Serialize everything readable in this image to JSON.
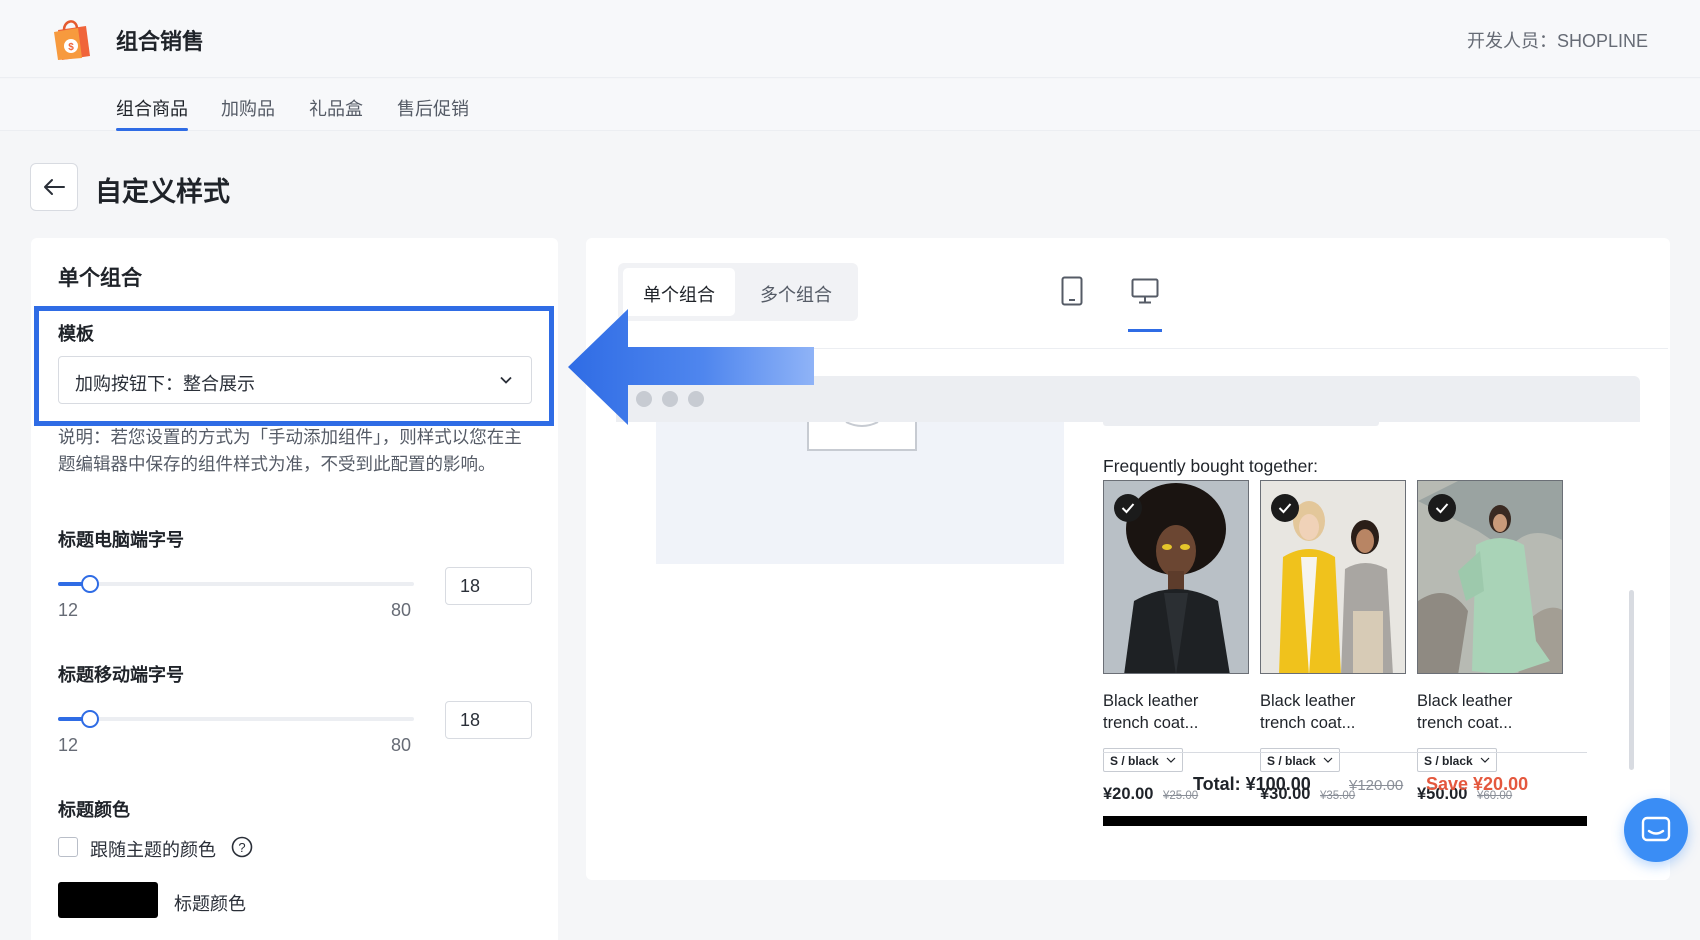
{
  "header": {
    "app_title": "组合销售",
    "developer_label": "开发人员：SHOPLINE"
  },
  "tabs": [
    {
      "label": "组合商品",
      "active": true
    },
    {
      "label": "加购品",
      "active": false
    },
    {
      "label": "礼品盒",
      "active": false
    },
    {
      "label": "售后促销",
      "active": false
    }
  ],
  "page": {
    "title": "自定义样式"
  },
  "settings": {
    "section_title": "单个组合",
    "template_label": "模板",
    "template_value": "加购按钮下：整合展示",
    "hint": "说明：若您设置的方式为「手动添加组件」，则样式以您在主题编辑器中保存的组件样式为准，不受到此配置的影响。",
    "desktop_size": {
      "label": "标题电脑端字号",
      "min": "12",
      "max": "80",
      "value": "18"
    },
    "mobile_size": {
      "label": "标题移动端字号",
      "min": "12",
      "max": "80",
      "value": "18"
    },
    "title_color": {
      "label": "标题颜色",
      "follow_theme_label": "跟随主题的颜色",
      "follow_theme_checked": false,
      "swatch_label": "标题颜色",
      "color": "#000000"
    }
  },
  "preview": {
    "segments": [
      {
        "label": "单个组合",
        "active": true
      },
      {
        "label": "多个组合",
        "active": false
      }
    ],
    "device": "desktop",
    "widget": {
      "title": "Frequently bought together:",
      "products": [
        {
          "name_line1": "Black leather",
          "name_line2": "trench coat...",
          "variant": "S / black",
          "price": "¥20.00",
          "old_price": "¥25.00",
          "checked": true
        },
        {
          "name_line1": "Black leather",
          "name_line2": "trench coat...",
          "variant": "S / black",
          "price": "¥30.00",
          "old_price": "¥35.00",
          "checked": true
        },
        {
          "name_line1": "Black leather",
          "name_line2": "trench coat...",
          "variant": "S / black",
          "price": "¥50.00",
          "old_price": "¥60.00",
          "checked": true
        }
      ],
      "total_label": "Total: ¥100.00",
      "total_old": "¥120.00",
      "save_label": "Save ¥20.00"
    }
  },
  "colors": {
    "accent": "#2f6ce5",
    "save": "#e4583e",
    "chat": "#3a8df5"
  }
}
